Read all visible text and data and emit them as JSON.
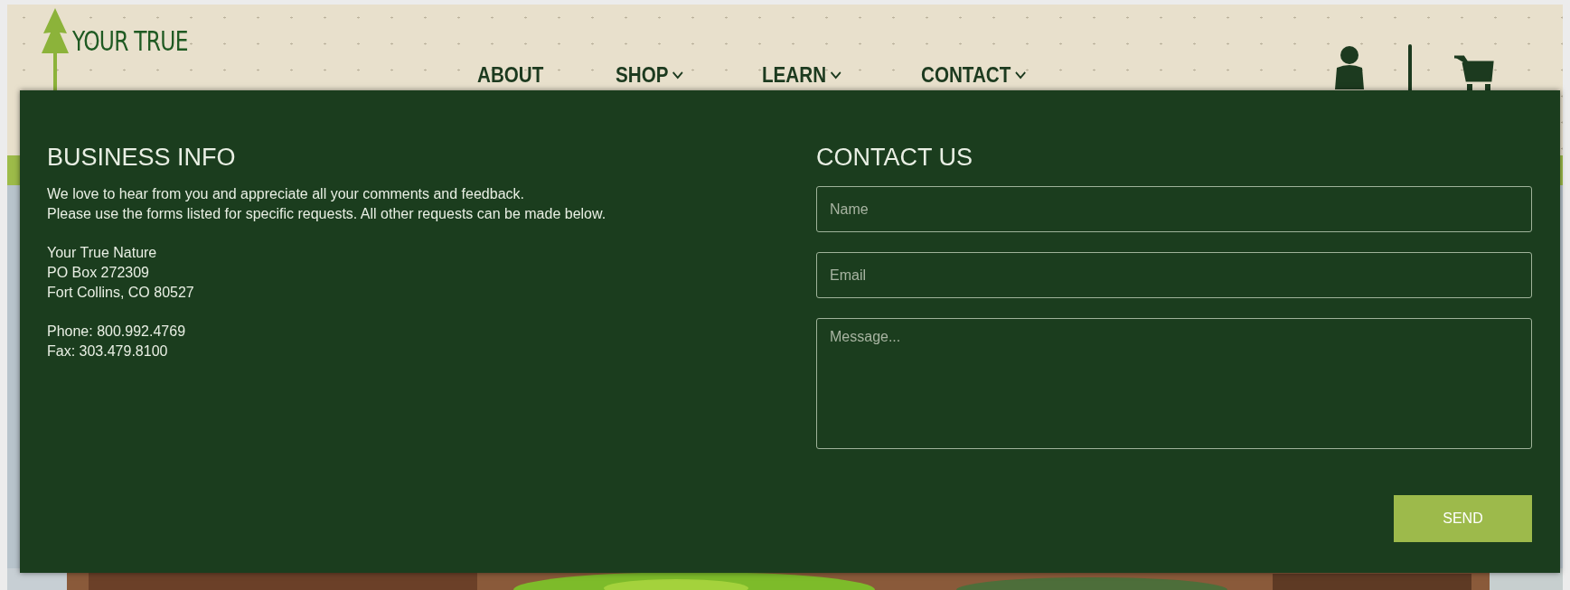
{
  "logo": {
    "text": "YOUR TRUE"
  },
  "nav": [
    {
      "label": "ABOUT",
      "dropdown": false
    },
    {
      "label": "SHOP",
      "dropdown": true
    },
    {
      "label": "LEARN",
      "dropdown": true
    },
    {
      "label": "CONTACT",
      "dropdown": true
    }
  ],
  "business_info": {
    "title": "BUSINESS INFO",
    "intro": [
      "We love to hear from you and appreciate all your comments and feedback.",
      "Please use the forms listed for specific requests. All other requests can be made below."
    ],
    "address": [
      "Your True Nature",
      "PO Box 272309",
      "Fort Collins, CO 80527"
    ],
    "contact_lines": [
      "Phone: 800.992.4769",
      "Fax: 303.479.8100"
    ]
  },
  "contact_form": {
    "title": "CONTACT US",
    "fields": [
      {
        "kind": "input",
        "placeholder": "Name"
      },
      {
        "kind": "input",
        "placeholder": "Email"
      },
      {
        "kind": "textarea",
        "placeholder": "Message..."
      }
    ],
    "submit": "SEND"
  }
}
